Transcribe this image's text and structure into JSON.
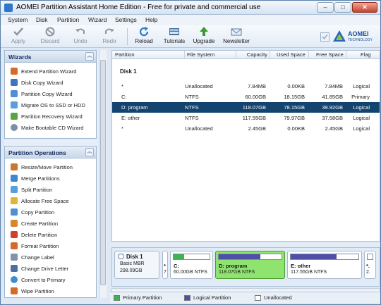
{
  "window": {
    "title": "AOMEI Partition Assistant Home Edition - Free for private and commercial use"
  },
  "menu": [
    "System",
    "Disk",
    "Partition",
    "Wizard",
    "Settings",
    "Help"
  ],
  "toolbar": {
    "apply": "Apply",
    "discard": "Discard",
    "undo": "Undo",
    "redo": "Redo",
    "reload": "Reload",
    "tutorials": "Tutorials",
    "upgrade": "Upgrade",
    "newsletter": "Newsletter"
  },
  "logo": {
    "brand": "AOMEI",
    "sub": "TECHNOLOGY"
  },
  "wizards": {
    "title": "Wizards",
    "items": [
      "Extend Partition Wizard",
      "Disk Copy Wizard",
      "Partition Copy Wizard",
      "Migrate OS to SSD or HDD",
      "Partition Recovery Wizard",
      "Make Bootable CD Wizard"
    ]
  },
  "operations": {
    "title": "Partition Operations",
    "items": [
      "Resize/Move Partition",
      "Merge Partitions",
      "Split Partition",
      "Allocate Free Space",
      "Copy Partition",
      "Create Partition",
      "Delete Partition",
      "Format Partition",
      "Change Label",
      "Change Drive Letter",
      "Convert to Primary",
      "Wipe Partition"
    ]
  },
  "table": {
    "columns": [
      "Partition",
      "File System",
      "Capacity",
      "Used Space",
      "Free Space",
      "Flag"
    ],
    "disk_label": "Disk 1",
    "rows": [
      {
        "partition": "*",
        "fs": "Unallocated",
        "capacity": "7.84MB",
        "used": "0.00KB",
        "free": "7.84MB",
        "flag": "Logical"
      },
      {
        "partition": "C:",
        "fs": "NTFS",
        "capacity": "60.00GB",
        "used": "18.15GB",
        "free": "41.85GB",
        "flag": "Primary"
      },
      {
        "partition": "D: program",
        "fs": "NTFS",
        "capacity": "118.07GB",
        "used": "78.15GB",
        "free": "39.92GB",
        "flag": "Logical"
      },
      {
        "partition": "E: other",
        "fs": "NTFS",
        "capacity": "117.55GB",
        "used": "79.97GB",
        "free": "37.58GB",
        "flag": "Logical"
      },
      {
        "partition": "*",
        "fs": "Unallocated",
        "capacity": "2.45GB",
        "used": "0.00KB",
        "free": "2.45GB",
        "flag": "Logical"
      }
    ],
    "selected_row": 2
  },
  "diskmap": {
    "disk": {
      "name": "Disk 1",
      "type": "Basic MBR",
      "size": "298.09GB"
    },
    "blocks": [
      {
        "name": "*",
        "size": "7",
        "used_fraction": 0.0,
        "color": "#ffffff"
      },
      {
        "name": "C:",
        "size": "60.00GB NTFS",
        "used_fraction": 0.3,
        "color": "#3fb34f"
      },
      {
        "name": "D: program",
        "size": "118.07GB NTFS",
        "used_fraction": 0.66,
        "color": "#4f4fa8"
      },
      {
        "name": "E: other",
        "size": "117.55GB NTFS",
        "used_fraction": 0.68,
        "color": "#4f4fa8"
      },
      {
        "name": "*.",
        "size": "2.",
        "used_fraction": 0.0,
        "color": "#ffffff"
      }
    ]
  },
  "legend": [
    {
      "label": "Primary Partition",
      "color": "#3fb34f"
    },
    {
      "label": "Logical Partition",
      "color": "#4f4fa8"
    },
    {
      "label": "Unallocated",
      "color": "#ffffff"
    }
  ]
}
